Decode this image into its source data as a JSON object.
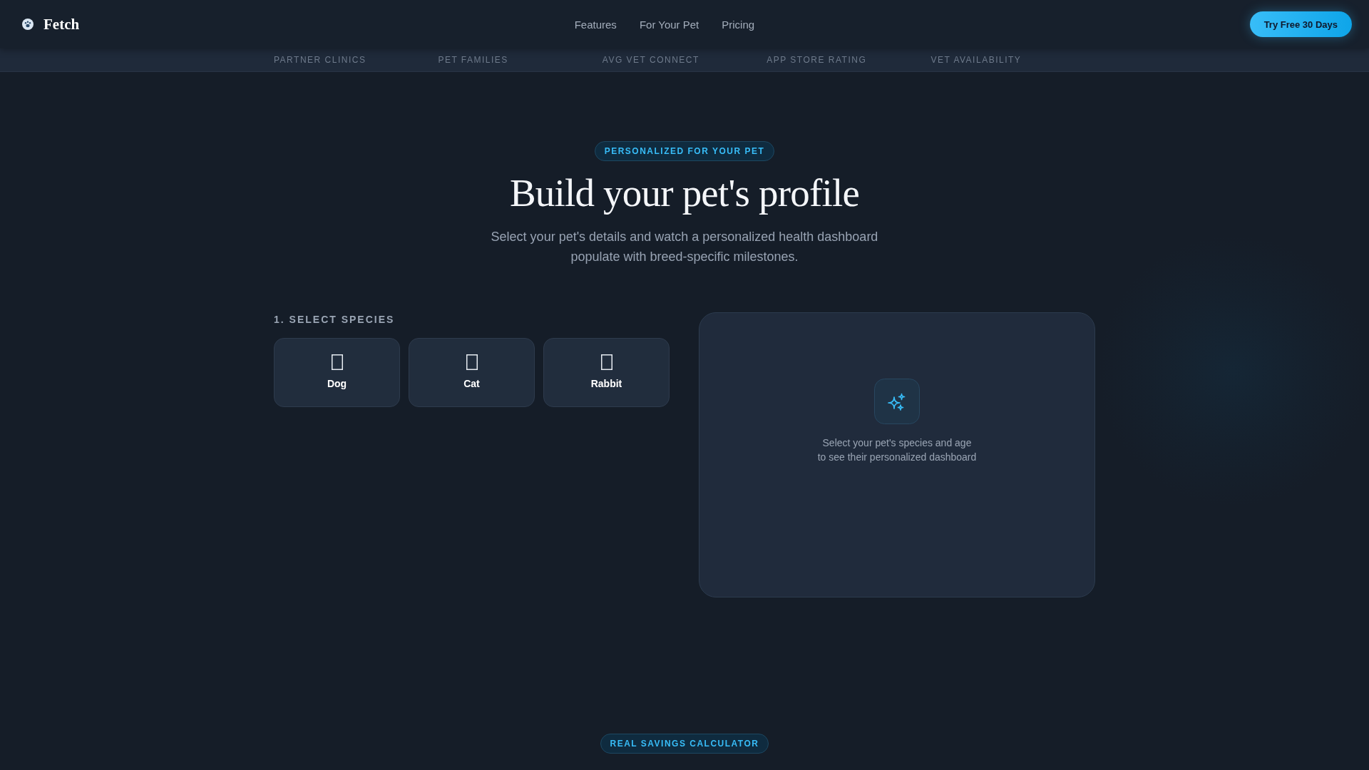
{
  "nav": {
    "brand": "Fetch",
    "links": [
      "Features",
      "For Your Pet",
      "Pricing"
    ],
    "cta": "Try Free 30 Days"
  },
  "stats_strip": {
    "labels": [
      "PARTNER CLINICS",
      "PET FAMILIES",
      "AVG VET CONNECT",
      "APP STORE RATING",
      "VET AVAILABILITY"
    ]
  },
  "profile_section": {
    "badge": "PERSONALIZED FOR YOUR PET",
    "title": "Build your pet's profile",
    "subtitle": "Select your pet's details and watch a personalized health dashboard populate with breed-specific milestones.",
    "species_step": {
      "label": "1. SELECT SPECIES",
      "options": [
        {
          "label": "Dog",
          "selected": false
        },
        {
          "label": "Cat",
          "selected": false
        },
        {
          "label": "Rabbit",
          "selected": false
        }
      ]
    },
    "dashboard_preview": {
      "message": "Select your pet's species and age\nto see their personalized dashboard"
    }
  },
  "savings_section": {
    "badge": "REAL SAVINGS CALCULATOR"
  }
}
